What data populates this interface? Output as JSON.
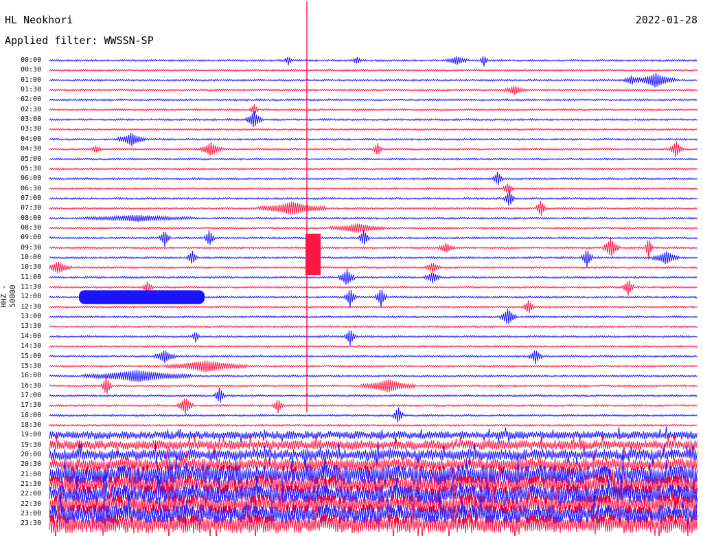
{
  "header": {
    "station": "HL Neokhori",
    "date": "2022-01-28",
    "filter": "Applied filter: WWSSN-SP"
  },
  "axis": {
    "ylabel": "HHZ - 50000"
  },
  "colors": {
    "blue": "#1a14ff",
    "red": "#ff1744"
  },
  "times": [
    "00:00",
    "00:30",
    "01:00",
    "01:30",
    "02:00",
    "02:30",
    "03:00",
    "03:30",
    "04:00",
    "04:30",
    "05:00",
    "05:30",
    "06:00",
    "06:30",
    "07:00",
    "07:30",
    "08:00",
    "08:30",
    "09:00",
    "09:30",
    "10:00",
    "10:30",
    "11:00",
    "11:30",
    "12:00",
    "12:30",
    "13:00",
    "13:30",
    "14:00",
    "14:30",
    "15:00",
    "15:30",
    "16:00",
    "16:30",
    "17:00",
    "17:30",
    "18:00",
    "18:30",
    "19:00",
    "19:30",
    "20:00",
    "20:30",
    "21:00",
    "21:30",
    "22:00",
    "22:30",
    "23:00",
    "23:30"
  ]
}
